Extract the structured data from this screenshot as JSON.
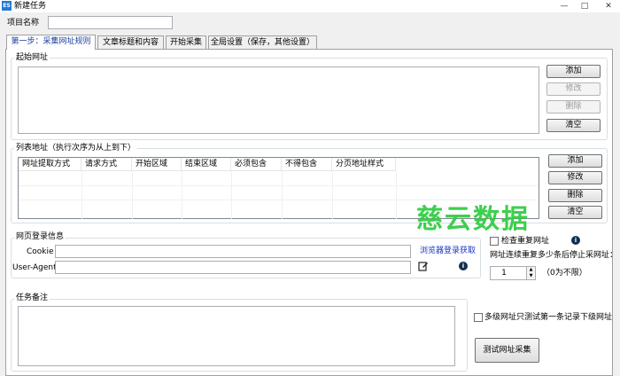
{
  "window": {
    "title": "新建任务",
    "icon_text": "ES",
    "controls": {
      "minimize": "—",
      "maximize": "□",
      "close": "✕"
    }
  },
  "project_name": {
    "label": "项目名称",
    "value": ""
  },
  "tabs": [
    {
      "label": "第一步：采集网址规则",
      "active": true
    },
    {
      "label": "文章标题和内容",
      "active": false
    },
    {
      "label": "开始采集",
      "active": false
    },
    {
      "label": "全局设置（保存，其他设置）",
      "active": false
    }
  ],
  "start_url": {
    "label": "起始网址",
    "buttons": {
      "add": "添加",
      "edit": "修改",
      "delete": "删除",
      "clear": "清空"
    }
  },
  "list_url": {
    "label": "列表地址（执行次序为从上到下）",
    "columns": [
      "网址提取方式",
      "请求方式",
      "开始区域",
      "结束区域",
      "必须包含",
      "不得包含",
      "分页地址样式"
    ],
    "buttons": {
      "add": "添加",
      "edit": "修改",
      "delete": "删除",
      "clear": "清空"
    }
  },
  "login": {
    "label": "网页登录信息",
    "cookie_label": "Cookie",
    "cookie_value": "",
    "ua_label": "User-Agent",
    "ua_value": "",
    "browser_link": "浏览器登录获取"
  },
  "dedupe": {
    "check_label": "检查重复网址",
    "checked": false,
    "stop_label": "网址连续重复多少条后停止采网址：",
    "stop_value": "1",
    "stop_hint": "（0为不限）"
  },
  "notes": {
    "label": "任务备注",
    "value": ""
  },
  "multi_level": {
    "label": "多级网址只测试第一条记录下级网址",
    "checked": false
  },
  "test_button": "测试网址采集",
  "watermark": "慈云数据",
  "colors": {
    "tab_active_text": "#1a3c9e",
    "link": "#1a34c4",
    "watermark": "#2ecc3f",
    "info_icon": "#0f2f52"
  }
}
